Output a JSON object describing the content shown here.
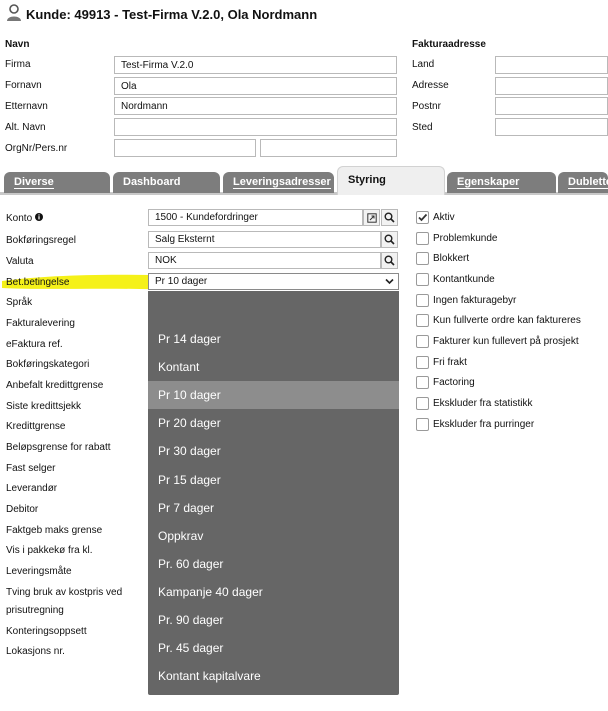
{
  "header": {
    "title": "Kunde: 49913 - Test-Firma V.2.0, Ola Nordmann",
    "icon": "user-icon"
  },
  "navn": {
    "section": "Navn",
    "fields": [
      {
        "label": "Firma",
        "value": "Test-Firma V.2.0"
      },
      {
        "label": "Fornavn",
        "value": "Ola"
      },
      {
        "label": "Etternavn",
        "value": "Nordmann"
      },
      {
        "label": "Alt. Navn",
        "value": ""
      }
    ],
    "orgnr_label": "OrgNr/Pers.nr",
    "orgnr_value_1": "",
    "orgnr_value_2": ""
  },
  "faktura": {
    "section": "Fakturaadresse",
    "fields": [
      {
        "label": "Land",
        "value": ""
      },
      {
        "label": "Adresse",
        "value": ""
      },
      {
        "label": "Postnr",
        "value": ""
      },
      {
        "label": "Sted",
        "value": ""
      }
    ]
  },
  "tabs": [
    {
      "label": "Diverse",
      "active": false
    },
    {
      "label": "Dashboard",
      "active": false
    },
    {
      "label": "Leveringsadresser",
      "active": false
    },
    {
      "label": "Styring",
      "active": true
    },
    {
      "label": "Egenskaper",
      "active": false
    },
    {
      "label": "Dubletter",
      "active": false
    }
  ],
  "styring": {
    "labels": [
      "Konto",
      "Bokføringsregel",
      "Valuta",
      "Bet.betingelse",
      "Språk",
      "Fakturalevering",
      "eFaktura ref.",
      "Bokføringskategori",
      "Anbefalt kredittgrense",
      "Siste kredittsjekk",
      "Kredittgrense",
      "Beløpsgrense for rabatt",
      "Fast selger",
      "Leverandør",
      "Debitor",
      "Faktgeb maks grense",
      "Vis i pakkekø fra kl.",
      "Leveringsmåte",
      "Tving bruk av kostpris ved",
      "prisutregning",
      "Konteringsoppsett",
      "Lokasjons nr."
    ],
    "konto_value": "1500 - Kundefordringer",
    "bokforingsregel_value": "Salg Eksternt",
    "valuta_value": "NOK",
    "betbetingelse_value": "Pr 10 dager",
    "dropdown_options": [
      "Pr 14 dager",
      "Kontant",
      "Pr 10 dager",
      "Pr 20 dager",
      "Pr 30 dager",
      "Pr 15 dager",
      "Pr 7 dager",
      "Oppkrav",
      "Pr. 60 dager",
      "Kampanje 40 dager",
      "Pr. 90 dager",
      "Pr. 45 dager",
      "Kontant kapitalvare"
    ],
    "selected_option": "Pr 10 dager"
  },
  "checkboxes": [
    {
      "label": "Aktiv",
      "checked": true
    },
    {
      "label": "Problemkunde",
      "checked": false
    },
    {
      "label": "Blokkert",
      "checked": false
    },
    {
      "label": "Kontantkunde",
      "checked": false
    },
    {
      "label": "Ingen fakturagebyr",
      "checked": false
    },
    {
      "label": "Kun fullverte ordre kan faktureres",
      "checked": false
    },
    {
      "label": "Fakturer kun fullevert på prosjekt",
      "checked": false
    },
    {
      "label": "Fri frakt",
      "checked": false
    },
    {
      "label": "Factoring",
      "checked": false
    },
    {
      "label": "Ekskluder fra statistikk",
      "checked": false
    },
    {
      "label": "Ekskluder fra purringer",
      "checked": false
    }
  ],
  "colors": {
    "tab_inactive": "#7d7d7d",
    "dropdown_bg": "#666666",
    "dropdown_selected": "#8d8d8d",
    "highlight": "#f4f000"
  }
}
